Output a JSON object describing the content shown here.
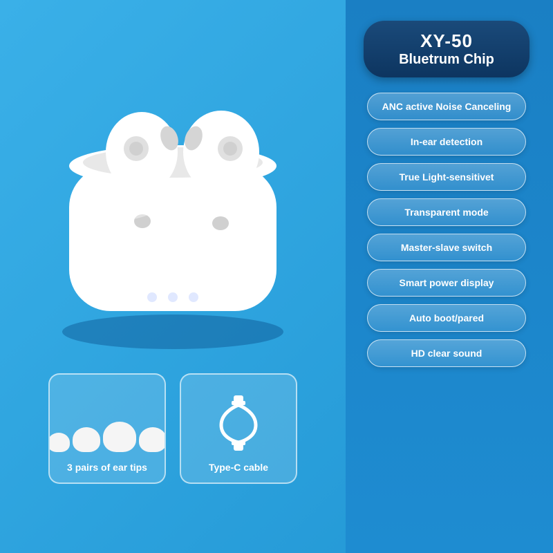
{
  "title": {
    "line1": "XY-50",
    "line2": "Bluetrum Chip"
  },
  "features": [
    {
      "label": "ANC active Noise Canceling"
    },
    {
      "label": "In-ear detection"
    },
    {
      "label": "True Light-sensitivet"
    },
    {
      "label": "Transparent mode"
    },
    {
      "label": "Master-slave switch"
    },
    {
      "label": "Smart power display"
    },
    {
      "label": "Auto boot/pared"
    },
    {
      "label": "HD clear sound"
    }
  ],
  "accessories": [
    {
      "label": "3 pairs of ear tips",
      "type": "ear-tips"
    },
    {
      "label": "Type-C cable",
      "type": "cable"
    }
  ]
}
